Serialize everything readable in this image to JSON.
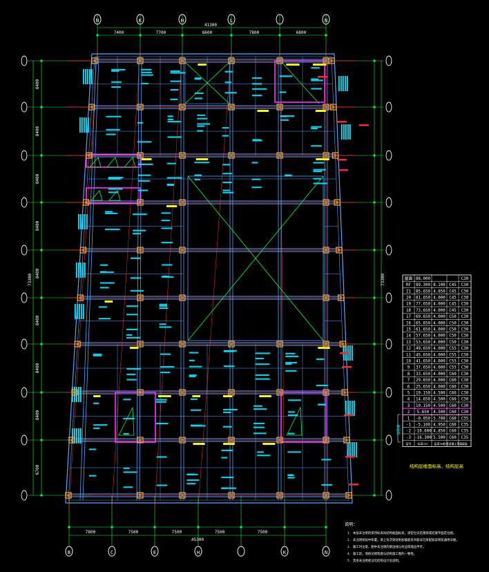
{
  "colors": {
    "background": "#000000",
    "beam": "#4aa8ff",
    "axis": "#ff2a2a",
    "dim": "#00ff40",
    "column": "#ff9a2a",
    "annotation": "#00e5ff",
    "highlight": "#ff30ff",
    "tag": "#ffff00",
    "text": "#ffffff"
  },
  "top_axis_labels": [
    "N",
    "K",
    "H",
    "L",
    "N"
  ],
  "top_dimensions": [
    "7400",
    "7700",
    "8600",
    "7800",
    "6800"
  ],
  "top_total": "41300",
  "bottom_axis_labels": [
    "B",
    "C",
    "E",
    "H",
    "K",
    "N"
  ],
  "bottom_dimensions": [
    "7800",
    "7500",
    "7500",
    "7500",
    "7500"
  ],
  "bottom_total": "45300",
  "left_dimensions": [
    "8400",
    "8400",
    "8400",
    "8400",
    "8400",
    "8400",
    "8400",
    "8400",
    "6700"
  ],
  "left_total": "73300",
  "right_total": "73300",
  "floor_table": {
    "rows": [
      {
        "floor": "屋面",
        "elev": "88.000",
        "height": "",
        "col": "",
        "slab": "C30"
      },
      {
        "floor": "RF",
        "elev": "89.300",
        "height": "8.100",
        "col": "C45",
        "slab": "C30"
      },
      {
        "floor": "21",
        "elev": "85.650",
        "height": "4.050",
        "col": "C45",
        "slab": "C30"
      },
      {
        "floor": "20",
        "elev": "81.650",
        "height": "4.000",
        "col": "C45",
        "slab": "C30"
      },
      {
        "floor": "19",
        "elev": "77.650",
        "height": "4.000",
        "col": "C45",
        "slab": "C30"
      },
      {
        "floor": "18",
        "elev": "73.650",
        "height": "4.000",
        "col": "C45",
        "slab": "C30"
      },
      {
        "floor": "17",
        "elev": "69.650",
        "height": "4.000",
        "col": "C50",
        "slab": "C30"
      },
      {
        "floor": "16",
        "elev": "65.650",
        "height": "4.000",
        "col": "C50",
        "slab": "C30"
      },
      {
        "floor": "15",
        "elev": "61.650",
        "height": "4.000",
        "col": "C50",
        "slab": "C30"
      },
      {
        "floor": "14",
        "elev": "57.650",
        "height": "4.000",
        "col": "C50",
        "slab": "C30"
      },
      {
        "floor": "13",
        "elev": "53.650",
        "height": "4.000",
        "col": "C50",
        "slab": "C30"
      },
      {
        "floor": "12",
        "elev": "49.650",
        "height": "4.000",
        "col": "C55",
        "slab": "C30"
      },
      {
        "floor": "11",
        "elev": "45.650",
        "height": "4.000",
        "col": "C55",
        "slab": "C30"
      },
      {
        "floor": "10",
        "elev": "41.650",
        "height": "4.000",
        "col": "C55",
        "slab": "C30"
      },
      {
        "floor": "9",
        "elev": "37.650",
        "height": "4.000",
        "col": "C55",
        "slab": "C30"
      },
      {
        "floor": "8",
        "elev": "33.650",
        "height": "4.000",
        "col": "C60",
        "slab": "C30"
      },
      {
        "floor": "7",
        "elev": "29.650",
        "height": "4.000",
        "col": "C60",
        "slab": "C30"
      },
      {
        "floor": "6",
        "elev": "25.650",
        "height": "4.000",
        "col": "C60",
        "slab": "C30"
      },
      {
        "floor": "5",
        "elev": "19.150",
        "height": "4.500",
        "col": "C60",
        "slab": "C30"
      },
      {
        "floor": "4",
        "elev": "14.650",
        "height": "4.500",
        "col": "C60",
        "slab": "C30"
      },
      {
        "floor": "3",
        "elev": "10.150",
        "height": "4.500",
        "col": "C60",
        "slab": "C30"
      },
      {
        "floor": "2",
        "elev": "5.650",
        "height": "4.500",
        "col": "C60",
        "slab": "C30"
      },
      {
        "floor": "1",
        "elev": "-0.050",
        "height": "5.700",
        "col": "C60",
        "slab": "C35"
      },
      {
        "floor": "-1",
        "elev": "-5.100",
        "height": "4.950",
        "col": "C60",
        "slab": "C35"
      },
      {
        "floor": "-2",
        "elev": "-10.600",
        "height": "4.850",
        "col": "C60",
        "slab": "C35"
      },
      {
        "floor": "-3",
        "elev": "-16.300",
        "height": "5.500",
        "col": "C60",
        "slab": "C35"
      }
    ],
    "header": {
      "floor": "层号",
      "elev": "标高(m)",
      "height": "层高(m)",
      "col": "柱墙混凝土等级",
      "slab": "梁板"
    },
    "caption": "结构层楼面标高、结构层高",
    "side_note": "嵌固端"
  },
  "notes": {
    "title": "说明：",
    "lines": [
      "1. 本层未注明的梁顶标高同结构板面标高，梁定位详见建施或结施平面定位图。",
      "2. 未注明梁居中布置，梁上有次梁处附加箍筋及吊筋详见梁配筋说明及通用详图。",
      "3. 施工时注意，图中未注明的梁边线与柱边或墙边平齐。",
      "4. 施工前，须核对建筑图与结构施工图的一致性。",
      "5. 其余未注明者详见结构设计总说明。"
    ]
  }
}
